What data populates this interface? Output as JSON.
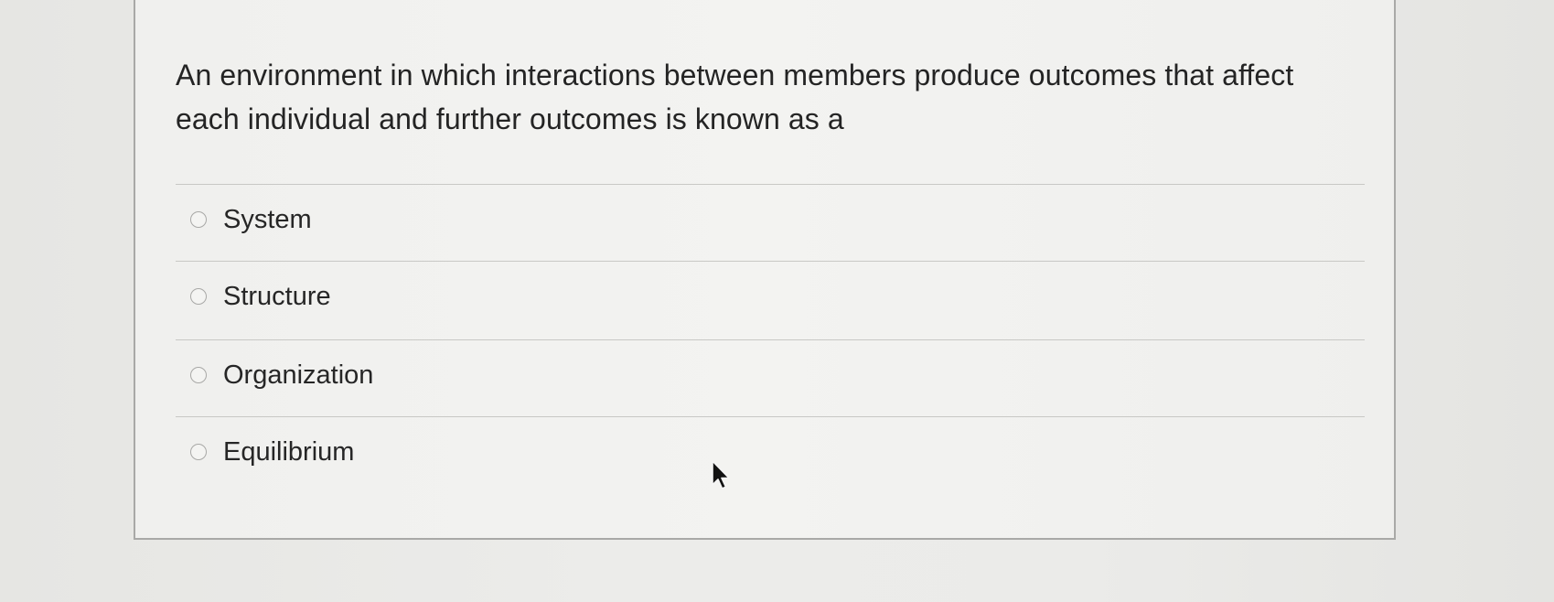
{
  "question": {
    "text": "An environment in which interactions between members produce outcomes that affect each individual and further outcomes is known as a"
  },
  "options": [
    {
      "label": "System",
      "selected": false
    },
    {
      "label": "Structure",
      "selected": false
    },
    {
      "label": "Organization",
      "selected": false
    },
    {
      "label": "Equilibrium",
      "selected": false
    }
  ],
  "icons": {
    "radio": "radio-unselected-icon",
    "cursor": "mouse-pointer-icon"
  },
  "colors": {
    "background": "#ebebe9",
    "card": "#f2f2f0",
    "border": "#a9a9a7",
    "text": "#242424"
  }
}
